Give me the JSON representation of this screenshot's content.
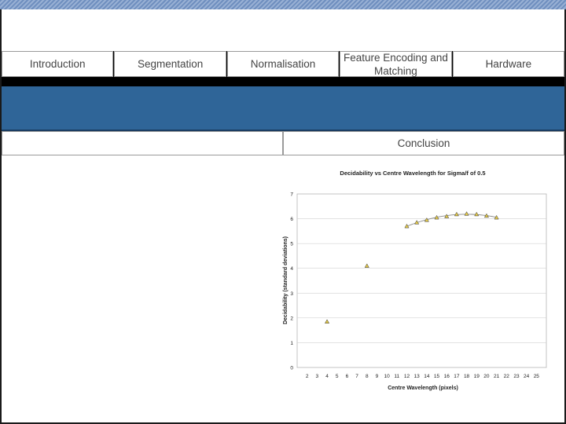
{
  "nav": {
    "tabs": [
      {
        "label": "Introduction"
      },
      {
        "label": "Segmentation"
      },
      {
        "label": "Normalisation"
      },
      {
        "label": "Feature Encoding and Matching"
      },
      {
        "label": "Hardware"
      }
    ]
  },
  "subnav": {
    "left_label": "",
    "right_label": "Conclusion"
  },
  "colors": {
    "banner": "#2f6598",
    "marker_fill": "#e3c94a",
    "trend_line": "#8a8a8a"
  },
  "chart_data": {
    "type": "scatter",
    "title": "Decidability vs Centre Wavelength for Sigma/f of 0.5",
    "xlabel": "Centre Wavelength (pixels)",
    "ylabel": "Decidability (standard deviations)",
    "xlim": [
      1,
      26
    ],
    "ylim": [
      0,
      7
    ],
    "x_ticks": [
      2,
      3,
      4,
      5,
      6,
      7,
      8,
      9,
      10,
      11,
      12,
      13,
      14,
      15,
      16,
      17,
      18,
      19,
      20,
      21,
      22,
      23,
      24,
      25
    ],
    "y_ticks": [
      0,
      1,
      2,
      3,
      4,
      5,
      6,
      7
    ],
    "grid": "horizontal",
    "legend": "none",
    "series": [
      {
        "marker": "triangle",
        "x": [
          4,
          8,
          12,
          13,
          14,
          15,
          16,
          17,
          18,
          19,
          20,
          21
        ],
        "y": [
          1.85,
          4.1,
          5.7,
          5.85,
          5.95,
          6.05,
          6.1,
          6.18,
          6.2,
          6.18,
          6.12,
          6.05
        ]
      }
    ],
    "trendline": {
      "x_range": [
        12,
        21
      ],
      "type": "polynomial"
    }
  }
}
